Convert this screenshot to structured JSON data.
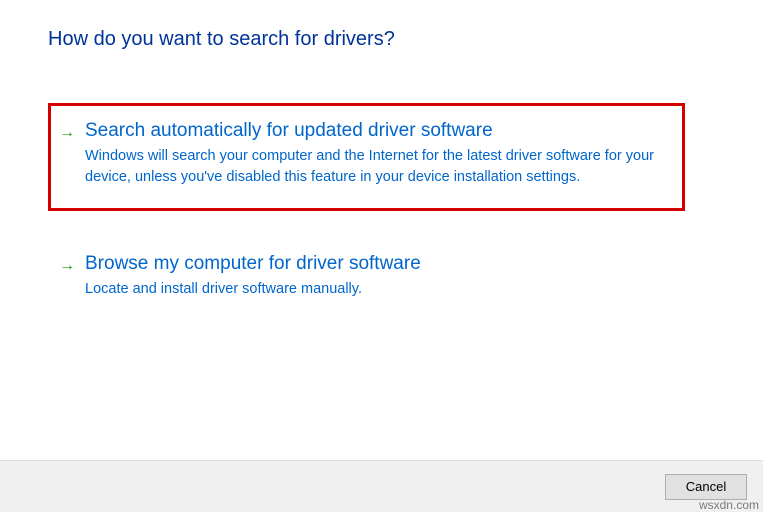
{
  "page": {
    "title": "How do you want to search for drivers?"
  },
  "options": {
    "auto": {
      "title": "Search automatically for updated driver software",
      "description": "Windows will search your computer and the Internet for the latest driver software for your device, unless you've disabled this feature in your device installation settings."
    },
    "browse": {
      "title": "Browse my computer for driver software",
      "description": "Locate and install driver software manually."
    }
  },
  "footer": {
    "cancel_label": "Cancel"
  },
  "watermark": "wsxdn.com"
}
